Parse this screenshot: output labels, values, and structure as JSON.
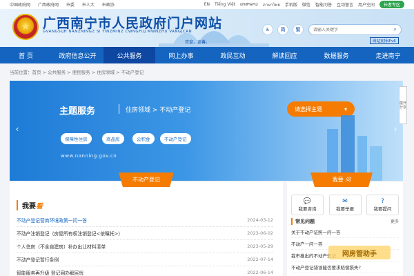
{
  "topbar": {
    "links": [
      "中国政府网",
      "广西政府网",
      "市委",
      "市人大",
      "市政协"
    ],
    "right": [
      "EN",
      "Tiếng Việt",
      "ພາສາລາວ",
      "ภาษาไทย",
      "手机版",
      "微信",
      "智能问答",
      "互动留言",
      "用户空间"
    ],
    "elder_mode": "长者专区"
  },
  "header": {
    "title": "广西南宁市人民政府门户网站",
    "subtitle": "GVANGSIJH NANZNINGZ SI YINZMINZ CWNGFUJ MWNZHU VANGJCAN",
    "welcome": "欢迎，友善。",
    "acc_buttons": [
      "♿",
      "简",
      "繁"
    ],
    "search_placeholder": "请输入关键字",
    "ipv6": "网站支持IPv6"
  },
  "nav": [
    "首 页",
    "政府信息公开",
    "公共服务",
    "网上办事",
    "政民互动",
    "解读回应",
    "数据服务",
    "走进南宁"
  ],
  "breadcrumb": "当前位置：首页 > 公共服务 > 便民服务 > 住房领域 > 不动产登记",
  "banner": {
    "title": "主题服务",
    "path": "住房领域 > 不动产登记",
    "select_label": "请选择主题",
    "tags": [
      "保障性住房",
      "商品房",
      "公积金",
      "不动产登记"
    ],
    "url": "www.nanning.gov.cn",
    "side_label": "展开分享"
  },
  "left": {
    "ribbon": "不动产登记",
    "title_a": "我要",
    "title_b": "看",
    "news": [
      {
        "title": "不动产登记营商环境政策一问一答",
        "date": "2024-03-12"
      },
      {
        "title": "不动产注销登记（房屋所有权注销登记<依嘱托>）",
        "date": "2023-06-02"
      },
      {
        "title": "个人住房（不含自建房）补办出让材料清单",
        "date": "2023-05-29"
      },
      {
        "title": "不动产登记暂行条例",
        "date": "2022-07-14"
      },
      {
        "title": "智能服务再升级 登记网办解民忧",
        "date": "2022-06-14"
      }
    ]
  },
  "right": {
    "ribbon_a": "我要",
    "ribbon_b": "问",
    "asks": [
      "我要咨询",
      "我要举报",
      "我要提问"
    ],
    "faq_title": "常见问题",
    "more": "更多",
    "faqs": [
      "关于不动产证照一问一答",
      "不动产一问一答",
      "我市推出的不动产登记...",
      "不动产登记错误能否要求赔偿损失?"
    ],
    "watermark": "网房管助手"
  },
  "colors": {
    "primary": "#1565c0",
    "accent": "#f57c00"
  }
}
